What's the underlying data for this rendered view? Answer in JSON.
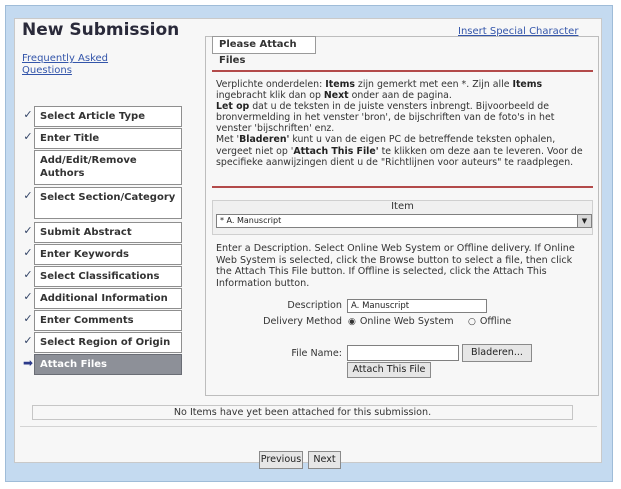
{
  "page": {
    "title": "New Submission",
    "faq_link": "Frequently Asked Questions",
    "special_char_link": "Insert Special Character"
  },
  "steps": [
    {
      "label": "Select Article Type",
      "mark": "✓",
      "current": false
    },
    {
      "label": "Enter Title",
      "mark": "✓",
      "current": false
    },
    {
      "label": "Add/Edit/Remove Authors",
      "mark": "",
      "current": false
    },
    {
      "label": "Select Section/Category",
      "mark": "✓",
      "current": false
    },
    {
      "label": "Submit Abstract",
      "mark": "✓",
      "current": false
    },
    {
      "label": "Enter Keywords",
      "mark": "✓",
      "current": false
    },
    {
      "label": "Select Classifications",
      "mark": "✓",
      "current": false
    },
    {
      "label": "Additional Information",
      "mark": "✓",
      "current": false
    },
    {
      "label": "Enter Comments",
      "mark": "✓",
      "current": false
    },
    {
      "label": "Select Region of Origin",
      "mark": "✓",
      "current": false
    },
    {
      "label": "Attach Files",
      "mark": "➡",
      "current": true
    }
  ],
  "panel": {
    "title": "Please Attach Files",
    "info": {
      "t1": "Verplichte onderdelen: ",
      "b1": "Items",
      "t2": " zijn gemerkt met een *. Zijn alle ",
      "b2": "Items",
      "t3": " ingebracht klik dan op ",
      "b3": "Next",
      "t4": " onder aan de pagina.",
      "b4": "Let op",
      "t5": " dat u de teksten in de juiste vensters inbrengt. Bijvoorbeeld de bronvermelding in het venster 'bron', de bijschriften van de foto's in het venster 'bijschriften' enz.",
      "t6": "Met '",
      "b5": "Bladeren'",
      "t7": " kunt u van de eigen PC de betreffende teksten ophalen, vergeet niet op '",
      "b6": "Attach This File'",
      "t8": " te klikken om deze aan te leveren. Voor de specifieke aanwijzingen dient u de \"Richtlijnen voor auteurs\" te raadplegen."
    },
    "item_header": "Item",
    "item_selected": "* A. Manuscript",
    "instructions": "Enter a Description. Select Online Web System or Offline delivery. If Online Web System is selected, click the Browse button to select a file, then click the Attach This File button. If Offline is selected, click the Attach This Information button.",
    "description_label": "Description",
    "description_value": "A. Manuscript",
    "delivery_label": "Delivery Method",
    "delivery_online": "Online Web System",
    "delivery_offline": "Offline",
    "delivery_selected": "online",
    "file_name_label": "File Name:",
    "browse_button": "Bladeren...",
    "attach_button": "Attach This File"
  },
  "status": "No Items have yet been attached for this submission.",
  "nav": {
    "previous": "Previous",
    "next": "Next"
  }
}
